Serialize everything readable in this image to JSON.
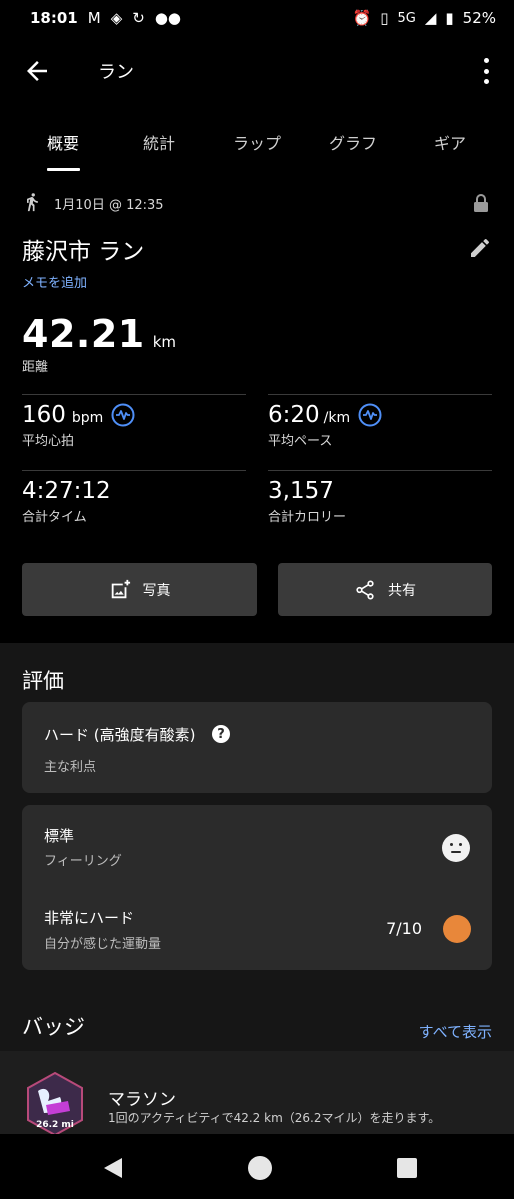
{
  "status_bar": {
    "time": "18:01",
    "network": "5G",
    "battery": "52%"
  },
  "app_bar": {
    "title": "ラン"
  },
  "tabs": [
    {
      "label": "概要",
      "active": true
    },
    {
      "label": "統計",
      "active": false
    },
    {
      "label": "ラップ",
      "active": false
    },
    {
      "label": "グラフ",
      "active": false
    },
    {
      "label": "ギア",
      "active": false
    }
  ],
  "activity": {
    "datetime": "1月10日 @ 12:35",
    "title": "藤沢市 ラン",
    "add_memo": "メモを追加",
    "distance": {
      "value": "42.21",
      "unit": "km",
      "label": "距離"
    },
    "avg_hr": {
      "value": "160",
      "unit": "bpm",
      "label": "平均心拍"
    },
    "avg_pace": {
      "value": "6:20",
      "unit": "/km",
      "label": "平均ペース"
    },
    "total_time": {
      "value": "4:27:12",
      "label": "合計タイム"
    },
    "calories": {
      "value": "3,157",
      "label": "合計カロリー"
    }
  },
  "buttons": {
    "photo": "写真",
    "share": "共有"
  },
  "evaluation": {
    "section_title": "評価",
    "training_effect": {
      "title": "ハード (高強度有酸素)",
      "subtitle": "主な利点"
    },
    "feeling": {
      "title": "標準",
      "subtitle": "フィーリング"
    },
    "effort": {
      "title": "非常にハード",
      "subtitle": "自分が感じた運動量",
      "score": "7/10",
      "color": "#e8873a"
    }
  },
  "badges": {
    "section_title": "バッジ",
    "see_all": "すべて表示",
    "items": [
      {
        "title": "マラソン",
        "description": "1回のアクティビティで42.2 km（26.2マイル）を走ります。",
        "badge_text": "26.2 mi"
      }
    ]
  },
  "colors": {
    "accent_link": "#7fb2ff",
    "wave_icon": "#4f8ff7",
    "card_bg": "#2b2b2b"
  }
}
